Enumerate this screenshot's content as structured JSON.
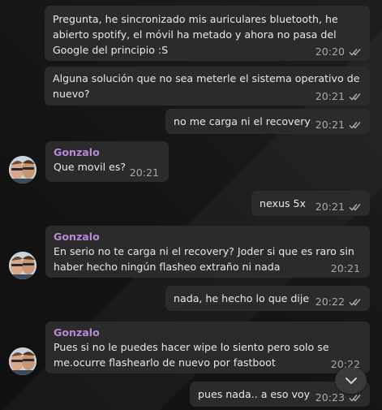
{
  "messages": [
    {
      "text": "Pregunta, he sincronizado mis auriculares bluetooth, he abierto spotify, el móvil ha metado y ahora no pasa del Google del principio :S",
      "time": "20:20",
      "status_icon": "double-check-icon"
    },
    {
      "text": "Alguna solución que no sea meterle el sistema operativo de nuevo?",
      "time": "20:21",
      "status_icon": "double-check-icon"
    },
    {
      "text": "no me carga ni el recovery",
      "time": "20:21",
      "status_icon": "double-check-icon"
    },
    {
      "sender": "Gonzalo",
      "text": "Que movil es?",
      "time": "20:21"
    },
    {
      "text": "nexus 5x",
      "time": "20:21",
      "status_icon": "double-check-icon"
    },
    {
      "sender": "Gonzalo",
      "text": "En serio no te carga ni el recovery? Joder si que es raro sin haber hecho ningún flasheo extraño ni nada",
      "time": "20:21"
    },
    {
      "text": "nada, he hecho lo que dije",
      "time": "20:22",
      "status_icon": "double-check-icon"
    },
    {
      "sender": "Gonzalo",
      "text": "Pues si no le puedes hacer wipe lo siento pero solo se me.ocurre flashearlo de nuevo por fastboot",
      "time": "20:22"
    },
    {
      "text": "pues nada.. a eso voy",
      "time": "20:23",
      "status_icon": "double-check-icon"
    }
  ],
  "colors": {
    "bubble": "#2b2b2b",
    "text": "#e9e9e9",
    "sender_name": "#b889d9",
    "meta": "#a9a9a9"
  },
  "scroll_button_icon": "chevron-down-icon"
}
